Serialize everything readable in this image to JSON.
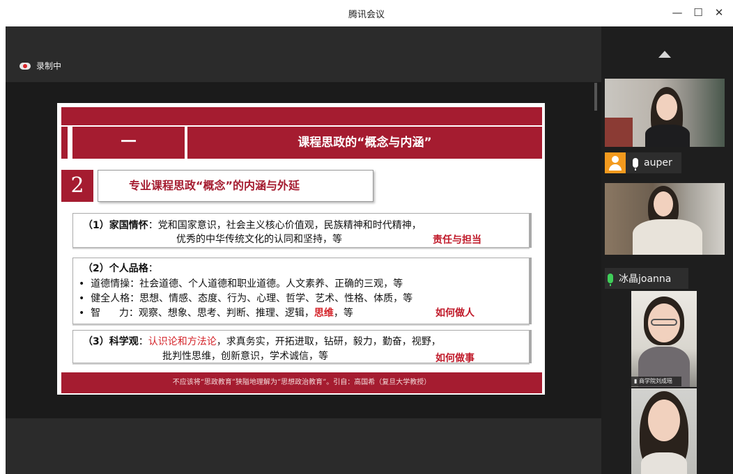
{
  "window": {
    "title": "腾讯会议",
    "minimize_glyph": "—",
    "maximize_glyph": "☐",
    "close_glyph": "✕"
  },
  "recording": {
    "label": "录制中",
    "icon": "cloud-record-icon"
  },
  "slide": {
    "section_number": "一",
    "section_title": "课程思政的“概念与内涵”",
    "item_number": "2",
    "item_title": "专业课程思政“概念”的内涵与外延",
    "box1": {
      "heading": "（1）家国情怀",
      "line1": "：党和国家意识，社会主义核心价值观，民族精神和时代精神，",
      "line2": "优秀的中华传统文化的认同和坚持，等",
      "tag": "责任与担当"
    },
    "box2": {
      "heading": "（2）个人品格",
      "heading_suffix": "：",
      "bullet": "•",
      "b1_label": "道德情操",
      "b1_text": "：社会道德、个人道德和职业道德。人文素养、正确的三观，等",
      "b2_label": "健全人格",
      "b2_text": "：思想、情感、态度、行为、心理、哲学、艺术、性格、体质，等",
      "b3_label": "智      力",
      "b3_text_a": "：观察、想象、思考、判断、推理、逻辑，",
      "b3_text_red": "思维",
      "b3_text_b": "，等",
      "tag": "如何做人"
    },
    "box3": {
      "heading": "（3）科学观",
      "colon": "：",
      "red_text": "认识论和方法论",
      "line1_rest": "，求真务实，开拓进取，钻研，毅力，勤奋，视野，",
      "line2": "批判性思维，创新意识，学术诚信，等",
      "tag": "如何做事"
    },
    "footer": "不应该将“思政教育”狭隘地理解为“思想政治教育”。引自：高国希（复旦大学教授）"
  },
  "participants": [
    {
      "name": "auper",
      "avatar_icon": "user-avatar-icon",
      "mic_icon": "mic-icon"
    },
    {
      "name": "冰晶joanna",
      "mic_icon": "mic-active-icon"
    },
    {
      "name": "商学院刘成瑶",
      "mic_icon": "mic-icon"
    },
    {
      "name": ""
    }
  ],
  "colors": {
    "brand_red": "#a51c30",
    "text_red": "#d4242a",
    "mic_green": "#3fce59",
    "avatar_orange": "#f39a1e"
  }
}
